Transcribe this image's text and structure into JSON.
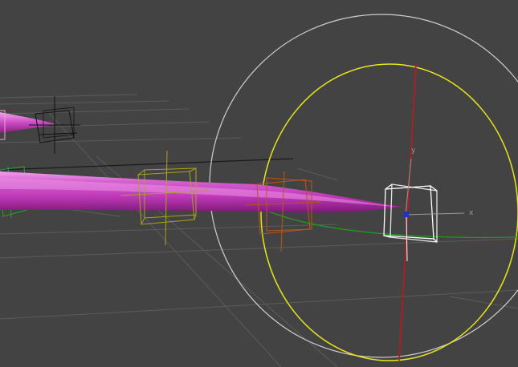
{
  "viewport": {
    "background": "#434343",
    "gizmo": {
      "x_axis_label": "x",
      "y_axis_label": "y"
    },
    "colors": {
      "tube_base": "#c23ebd",
      "tube_highlight": "#e98ae3",
      "tube_shadow": "#8c1e86",
      "rotate_outer_ring": "#cfcfcf",
      "rotate_view_ring": "#e8e61c",
      "rotate_red_axis": "#c4161c",
      "rotate_green_axis": "#1f9a1f",
      "grid_line": "#5e5e5e",
      "bone_box_active": "#ffffff",
      "bone_box_orange": "#b8561c",
      "bone_box_yellow": "#a8a321",
      "bone_box_green": "#27a327",
      "bone_box_black": "#111111",
      "bone_box_pink": "#f0a0d0"
    }
  }
}
